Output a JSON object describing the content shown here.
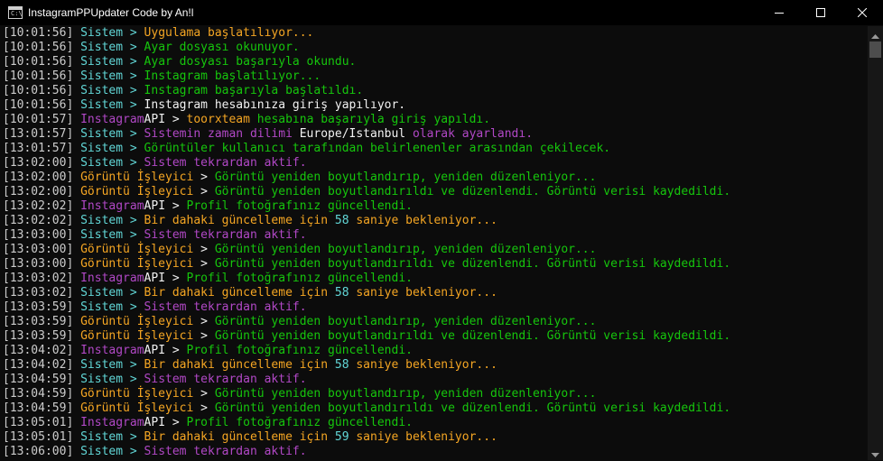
{
  "window": {
    "title": "InstagramPPUpdater Code by An!l",
    "icon": "console-icon",
    "icon_text": "C:\\",
    "controls": [
      "minimize-icon",
      "maximize-icon",
      "close-icon"
    ]
  },
  "colors": {
    "gray": "#cccccc",
    "cyan": "#61d6d6",
    "yellow": "#f9f1a5",
    "orange": "#f5a623",
    "green": "#16c60c",
    "magenta": "#b148c6",
    "white": "#f2f2f2"
  },
  "console": {
    "lines": [
      {
        "segments": [
          {
            "t": "[10:01:56] ",
            "c": "gray"
          },
          {
            "t": "Sistem > ",
            "c": "cyan"
          },
          {
            "t": "Uygulama başlatılıyor...",
            "c": "orange"
          }
        ]
      },
      {
        "segments": [
          {
            "t": "[10:01:56] ",
            "c": "gray"
          },
          {
            "t": "Sistem > ",
            "c": "cyan"
          },
          {
            "t": "Ayar dosyası okunuyor.",
            "c": "green"
          }
        ]
      },
      {
        "segments": [
          {
            "t": "[10:01:56] ",
            "c": "gray"
          },
          {
            "t": "Sistem > ",
            "c": "cyan"
          },
          {
            "t": "Ayar dosyası başarıyla okundu.",
            "c": "green"
          }
        ]
      },
      {
        "segments": [
          {
            "t": "[10:01:56] ",
            "c": "gray"
          },
          {
            "t": "Sistem > ",
            "c": "cyan"
          },
          {
            "t": "Instagram başlatılıyor...",
            "c": "green"
          }
        ]
      },
      {
        "segments": [
          {
            "t": "[10:01:56] ",
            "c": "gray"
          },
          {
            "t": "Sistem > ",
            "c": "cyan"
          },
          {
            "t": "Instagram başarıyla başlatıldı.",
            "c": "green"
          }
        ]
      },
      {
        "segments": [
          {
            "t": "[10:01:56] ",
            "c": "gray"
          },
          {
            "t": "Sistem > ",
            "c": "cyan"
          },
          {
            "t": "Instagram hesabınıza giriş yapılıyor.",
            "c": "white"
          }
        ]
      },
      {
        "segments": [
          {
            "t": "[10:01:57] ",
            "c": "gray"
          },
          {
            "t": "Instagram",
            "c": "magenta"
          },
          {
            "t": "API > ",
            "c": "white"
          },
          {
            "t": "toorxteam",
            "c": "orange"
          },
          {
            "t": " hesabına başarıyla giriş yapıldı.",
            "c": "green"
          }
        ]
      },
      {
        "segments": [
          {
            "t": "[13:01:57] ",
            "c": "gray"
          },
          {
            "t": "Sistem > ",
            "c": "cyan"
          },
          {
            "t": "Sistemin zaman dilimi ",
            "c": "magenta"
          },
          {
            "t": "Europe/Istanbul",
            "c": "white"
          },
          {
            "t": " olarak ayarlandı.",
            "c": "magenta"
          }
        ]
      },
      {
        "segments": [
          {
            "t": "[13:01:57] ",
            "c": "gray"
          },
          {
            "t": "Sistem > ",
            "c": "cyan"
          },
          {
            "t": "Görüntüler kullanıcı tarafından belirlenenler arasından çekilecek.",
            "c": "green"
          }
        ]
      },
      {
        "segments": [
          {
            "t": "[13:02:00] ",
            "c": "gray"
          },
          {
            "t": "Sistem > ",
            "c": "cyan"
          },
          {
            "t": "Sistem tekrardan aktif.",
            "c": "magenta"
          }
        ]
      },
      {
        "segments": [
          {
            "t": "[13:02:00] ",
            "c": "gray"
          },
          {
            "t": "Görüntü İşleyici",
            "c": "orange"
          },
          {
            "t": " > ",
            "c": "white"
          },
          {
            "t": "Görüntü yeniden boyutlandırıp, yeniden düzenleniyor...",
            "c": "green"
          }
        ]
      },
      {
        "segments": [
          {
            "t": "[13:02:00] ",
            "c": "gray"
          },
          {
            "t": "Görüntü İşleyici",
            "c": "orange"
          },
          {
            "t": " > ",
            "c": "white"
          },
          {
            "t": "Görüntü yeniden boyutlandırıldı ve düzenlendi. Görüntü verisi kaydedildi.",
            "c": "green"
          }
        ]
      },
      {
        "segments": [
          {
            "t": "[13:02:02] ",
            "c": "gray"
          },
          {
            "t": "Instagram",
            "c": "magenta"
          },
          {
            "t": "API > ",
            "c": "white"
          },
          {
            "t": "Profil fotoğrafınız güncellendi.",
            "c": "green"
          }
        ]
      },
      {
        "segments": [
          {
            "t": "[13:02:02] ",
            "c": "gray"
          },
          {
            "t": "Sistem > ",
            "c": "cyan"
          },
          {
            "t": "Bir dahaki güncelleme için ",
            "c": "orange"
          },
          {
            "t": "58",
            "c": "cyan"
          },
          {
            "t": " saniye bekleniyor...",
            "c": "orange"
          }
        ]
      },
      {
        "segments": [
          {
            "t": "[13:03:00] ",
            "c": "gray"
          },
          {
            "t": "Sistem > ",
            "c": "cyan"
          },
          {
            "t": "Sistem tekrardan aktif.",
            "c": "magenta"
          }
        ]
      },
      {
        "segments": [
          {
            "t": "[13:03:00] ",
            "c": "gray"
          },
          {
            "t": "Görüntü İşleyici",
            "c": "orange"
          },
          {
            "t": " > ",
            "c": "white"
          },
          {
            "t": "Görüntü yeniden boyutlandırıp, yeniden düzenleniyor...",
            "c": "green"
          }
        ]
      },
      {
        "segments": [
          {
            "t": "[13:03:00] ",
            "c": "gray"
          },
          {
            "t": "Görüntü İşleyici",
            "c": "orange"
          },
          {
            "t": " > ",
            "c": "white"
          },
          {
            "t": "Görüntü yeniden boyutlandırıldı ve düzenlendi. Görüntü verisi kaydedildi.",
            "c": "green"
          }
        ]
      },
      {
        "segments": [
          {
            "t": "[13:03:02] ",
            "c": "gray"
          },
          {
            "t": "Instagram",
            "c": "magenta"
          },
          {
            "t": "API > ",
            "c": "white"
          },
          {
            "t": "Profil fotoğrafınız güncellendi.",
            "c": "green"
          }
        ]
      },
      {
        "segments": [
          {
            "t": "[13:03:02] ",
            "c": "gray"
          },
          {
            "t": "Sistem > ",
            "c": "cyan"
          },
          {
            "t": "Bir dahaki güncelleme için ",
            "c": "orange"
          },
          {
            "t": "58",
            "c": "cyan"
          },
          {
            "t": " saniye bekleniyor...",
            "c": "orange"
          }
        ]
      },
      {
        "segments": [
          {
            "t": "[13:03:59] ",
            "c": "gray"
          },
          {
            "t": "Sistem > ",
            "c": "cyan"
          },
          {
            "t": "Sistem tekrardan aktif.",
            "c": "magenta"
          }
        ]
      },
      {
        "segments": [
          {
            "t": "[13:03:59] ",
            "c": "gray"
          },
          {
            "t": "Görüntü İşleyici",
            "c": "orange"
          },
          {
            "t": " > ",
            "c": "white"
          },
          {
            "t": "Görüntü yeniden boyutlandırıp, yeniden düzenleniyor...",
            "c": "green"
          }
        ]
      },
      {
        "segments": [
          {
            "t": "[13:03:59] ",
            "c": "gray"
          },
          {
            "t": "Görüntü İşleyici",
            "c": "orange"
          },
          {
            "t": " > ",
            "c": "white"
          },
          {
            "t": "Görüntü yeniden boyutlandırıldı ve düzenlendi. Görüntü verisi kaydedildi.",
            "c": "green"
          }
        ]
      },
      {
        "segments": [
          {
            "t": "[13:04:02] ",
            "c": "gray"
          },
          {
            "t": "Instagram",
            "c": "magenta"
          },
          {
            "t": "API > ",
            "c": "white"
          },
          {
            "t": "Profil fotoğrafınız güncellendi.",
            "c": "green"
          }
        ]
      },
      {
        "segments": [
          {
            "t": "[13:04:02] ",
            "c": "gray"
          },
          {
            "t": "Sistem > ",
            "c": "cyan"
          },
          {
            "t": "Bir dahaki güncelleme için ",
            "c": "orange"
          },
          {
            "t": "58",
            "c": "cyan"
          },
          {
            "t": " saniye bekleniyor...",
            "c": "orange"
          }
        ]
      },
      {
        "segments": [
          {
            "t": "[13:04:59] ",
            "c": "gray"
          },
          {
            "t": "Sistem > ",
            "c": "cyan"
          },
          {
            "t": "Sistem tekrardan aktif.",
            "c": "magenta"
          }
        ]
      },
      {
        "segments": [
          {
            "t": "[13:04:59] ",
            "c": "gray"
          },
          {
            "t": "Görüntü İşleyici",
            "c": "orange"
          },
          {
            "t": " > ",
            "c": "white"
          },
          {
            "t": "Görüntü yeniden boyutlandırıp, yeniden düzenleniyor...",
            "c": "green"
          }
        ]
      },
      {
        "segments": [
          {
            "t": "[13:04:59] ",
            "c": "gray"
          },
          {
            "t": "Görüntü İşleyici",
            "c": "orange"
          },
          {
            "t": " > ",
            "c": "white"
          },
          {
            "t": "Görüntü yeniden boyutlandırıldı ve düzenlendi. Görüntü verisi kaydedildi.",
            "c": "green"
          }
        ]
      },
      {
        "segments": [
          {
            "t": "[13:05:01] ",
            "c": "gray"
          },
          {
            "t": "Instagram",
            "c": "magenta"
          },
          {
            "t": "API > ",
            "c": "white"
          },
          {
            "t": "Profil fotoğrafınız güncellendi.",
            "c": "green"
          }
        ]
      },
      {
        "segments": [
          {
            "t": "[13:05:01] ",
            "c": "gray"
          },
          {
            "t": "Sistem > ",
            "c": "cyan"
          },
          {
            "t": "Bir dahaki güncelleme için ",
            "c": "orange"
          },
          {
            "t": "59",
            "c": "cyan"
          },
          {
            "t": " saniye bekleniyor...",
            "c": "orange"
          }
        ]
      },
      {
        "segments": [
          {
            "t": "[13:06:00] ",
            "c": "gray"
          },
          {
            "t": "Sistem > ",
            "c": "cyan"
          },
          {
            "t": "Sistem tekrardan aktif.",
            "c": "magenta"
          }
        ]
      }
    ]
  },
  "scrollbar": {
    "up_icon": "scroll-up-arrow-icon",
    "down_icon": "scroll-down-arrow-icon",
    "position": 0
  }
}
